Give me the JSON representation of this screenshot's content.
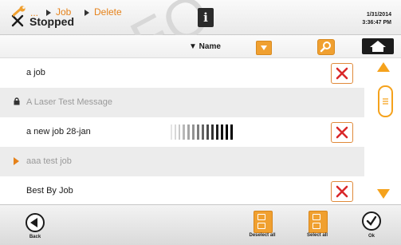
{
  "header": {
    "status": "Stopped",
    "date": "1/31/2014",
    "time": "3:36:47 PM",
    "watermark": "FO"
  },
  "toolbar": {
    "breadcrumb": [
      "...",
      "Job",
      "Delete"
    ],
    "sort_field": "▼ Name"
  },
  "jobs": [
    {
      "name": "a job",
      "style": "normal",
      "deletable": true
    },
    {
      "name": "A Laser Test Message",
      "style": "locked",
      "deletable": false
    },
    {
      "name": "a new job 28-jan",
      "style": "normal",
      "deletable": true
    },
    {
      "name": "aaa test job",
      "style": "active",
      "deletable": false
    },
    {
      "name": "Best By Job",
      "style": "normal",
      "deletable": true
    }
  ],
  "bottom": {
    "back_label": "Back",
    "deselect_label": "Deselect all",
    "select_label": "Select all",
    "ok_label": "Ok"
  },
  "colors": {
    "accent": "#f0a030",
    "delete_red": "#d9282a"
  }
}
